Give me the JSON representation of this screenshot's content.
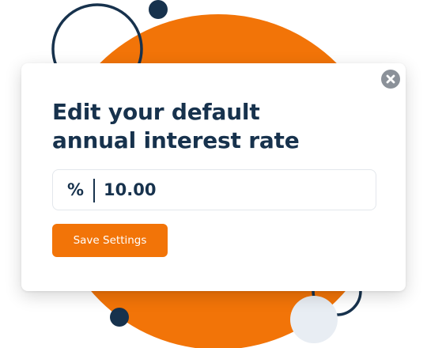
{
  "dialog": {
    "title_line1": "Edit your default",
    "title_line2": "annual interest rate",
    "close_icon": "close-x-icon"
  },
  "rate_field": {
    "unit": "%",
    "value": "10.00"
  },
  "actions": {
    "save_label": "Save Settings"
  },
  "colors": {
    "accent_orange": "#f27408",
    "navy": "#17324d",
    "close_gray": "#8b9199",
    "pale_circle": "#e8edf3"
  }
}
